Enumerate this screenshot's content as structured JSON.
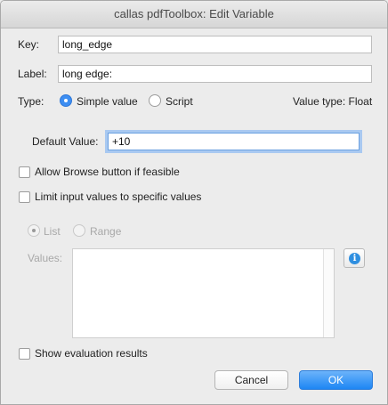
{
  "window": {
    "title": "callas pdfToolbox: Edit Variable"
  },
  "key": {
    "label": "Key:",
    "value": "long_edge"
  },
  "label_field": {
    "label": "Label:",
    "value": "long edge:"
  },
  "type": {
    "label": "Type:",
    "options": [
      {
        "label": "Simple value",
        "selected": true
      },
      {
        "label": "Script",
        "selected": false
      }
    ],
    "value_type": "Value type: Float"
  },
  "default_value": {
    "label": "Default Value:",
    "value": "+10"
  },
  "checkboxes": {
    "browse": {
      "label": "Allow Browse button if feasible",
      "checked": false
    },
    "limit": {
      "label": "Limit input values to specific values",
      "checked": false
    },
    "show_eval": {
      "label": "Show evaluation results",
      "checked": false
    }
  },
  "limit_mode": {
    "options": [
      {
        "label": "List",
        "selected": true
      },
      {
        "label": "Range",
        "selected": false
      }
    ]
  },
  "values": {
    "label": "Values:",
    "content": ""
  },
  "buttons": {
    "cancel": "Cancel",
    "ok": "OK"
  },
  "icons": {
    "info": "info-icon"
  },
  "colors": {
    "accent": "#1d86f4",
    "focus_ring": "#a9c9f1"
  }
}
